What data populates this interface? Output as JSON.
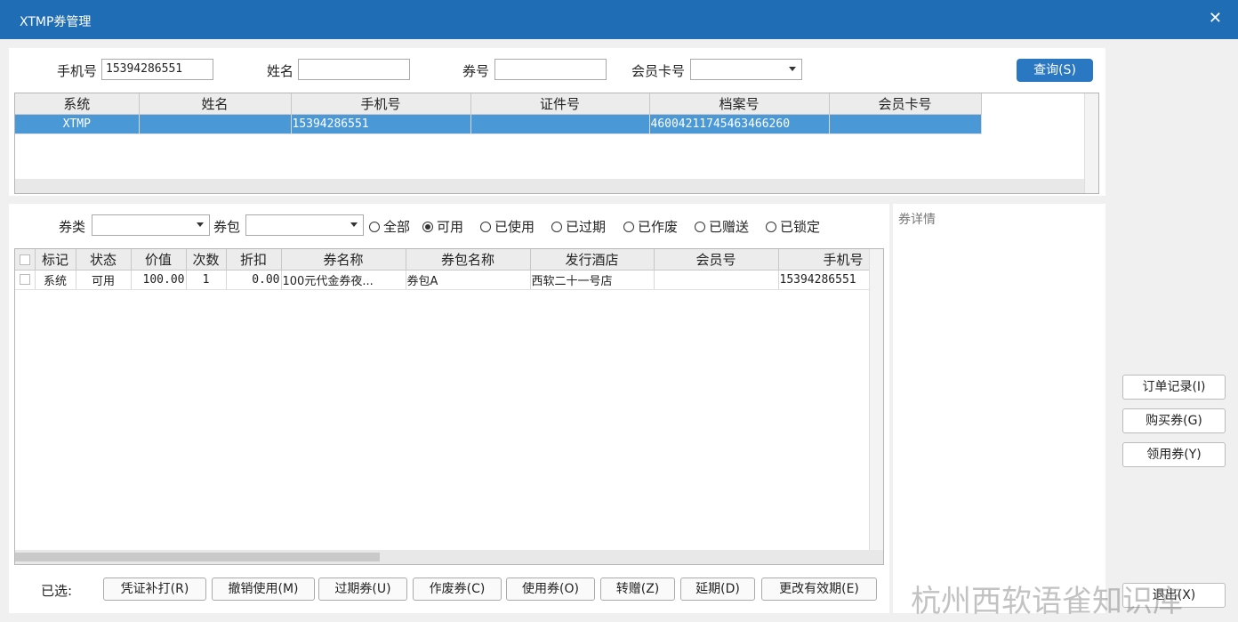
{
  "window": {
    "title": "XTMP券管理",
    "close_glyph": "✕"
  },
  "search": {
    "phone_label": "手机号",
    "phone_value": "15394286551",
    "name_label": "姓名",
    "name_value": "",
    "coupon_no_label": "券号",
    "coupon_no_value": "",
    "member_card_label": "会员卡号",
    "member_card_value": "",
    "query_button": "查询(S)"
  },
  "member_table": {
    "columns": [
      "系统",
      "姓名",
      "手机号",
      "证件号",
      "档案号",
      "会员卡号"
    ],
    "rows": [
      {
        "system": "XTMP",
        "name": "",
        "phone": "15394286551",
        "id_no": "",
        "file_no": "46004211745463466260",
        "card_no": ""
      }
    ]
  },
  "filter": {
    "type_label": "券类",
    "type_value": "",
    "package_label": "券包",
    "package_value": "",
    "statuses": [
      {
        "label": "全部",
        "checked": false
      },
      {
        "label": "可用",
        "checked": true
      },
      {
        "label": "已使用",
        "checked": false
      },
      {
        "label": "已过期",
        "checked": false
      },
      {
        "label": "已作废",
        "checked": false
      },
      {
        "label": "已赠送",
        "checked": false
      },
      {
        "label": "已锁定",
        "checked": false
      }
    ]
  },
  "coupon_table": {
    "columns": [
      "标记",
      "状态",
      "价值",
      "次数",
      "折扣",
      "券名称",
      "券包名称",
      "发行酒店",
      "会员号",
      "手机号"
    ],
    "rows": [
      {
        "mark": "系统",
        "status": "可用",
        "value": "100.00",
        "times": "1",
        "discount": "0.00",
        "name": "100元代金券夜...",
        "package": "券包A",
        "hotel": "西软二十一号店",
        "member_no": "",
        "phone": "15394286551"
      }
    ]
  },
  "detail": {
    "label": "券详情"
  },
  "bottom": {
    "selected_label": "已选:",
    "buttons": [
      "凭证补打(R)",
      "撤销使用(M)",
      "过期券(U)",
      "作废券(C)",
      "使用券(O)",
      "转赠(Z)",
      "延期(D)",
      "更改有效期(E)"
    ]
  },
  "side_buttons": [
    "订单记录(I)",
    "购买券(G)",
    "领用券(Y)"
  ],
  "exit_button": "退出(X)",
  "watermark": "杭州西软语雀知识库",
  "colors": {
    "titlebar": "#1f6db5",
    "selected_row": "#4a98d6",
    "primary_button": "#2a77c2"
  }
}
